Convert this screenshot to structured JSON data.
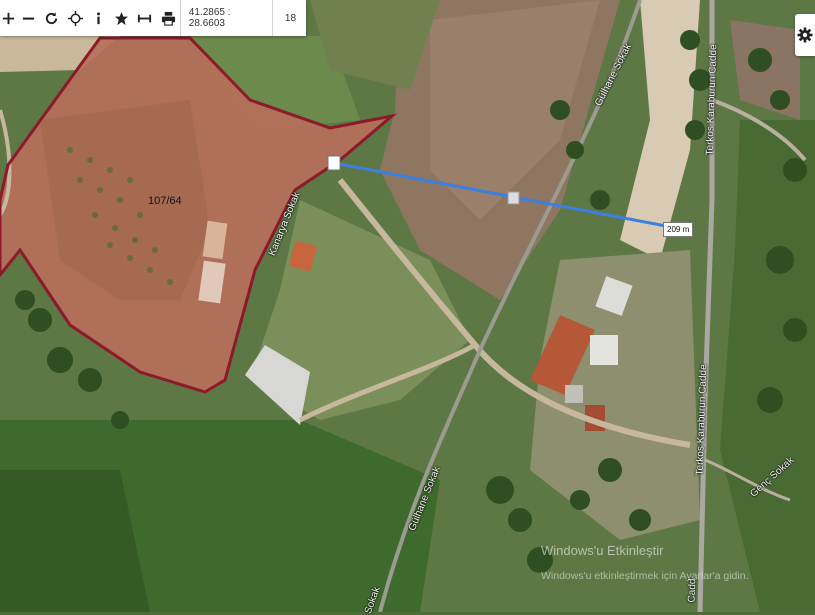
{
  "toolbar": {
    "zoom_in_icon": "plus-icon",
    "zoom_out_icon": "minus-icon",
    "refresh_icon": "refresh-icon",
    "locate_icon": "crosshair-icon",
    "info_icon": "info-icon",
    "favorite_icon": "star-icon",
    "measure_icon": "ruler-icon",
    "print_icon": "printer-icon",
    "coordinates": "41.2865 : 28.6603",
    "zoom_level": "18"
  },
  "settings_icon": "gear-icon",
  "map": {
    "parcel_label": "107/64",
    "distance_label": "209 m",
    "streets": {
      "kanarya": "Kanarya Sokak",
      "gulhane_upper": "Gülhane Sokak",
      "gulhane_lower": "Gülhane Sokak",
      "gulhane_bottom": "Sokak",
      "terkos_upper": "Terkos Karaburun Cadde",
      "terkos_lower": "Terkos Karaburun Cadde",
      "terkos_bottom": "Cadd",
      "genc": "Genç Sokak"
    },
    "colors": {
      "parcel_border": "#8c1a2b",
      "measure_line": "#3d7fe0"
    }
  },
  "watermark": {
    "line1": "Windows'u Etkinleştir",
    "line2": "Windows'u etkinleştirmek için Ayarlar'a gidin."
  }
}
